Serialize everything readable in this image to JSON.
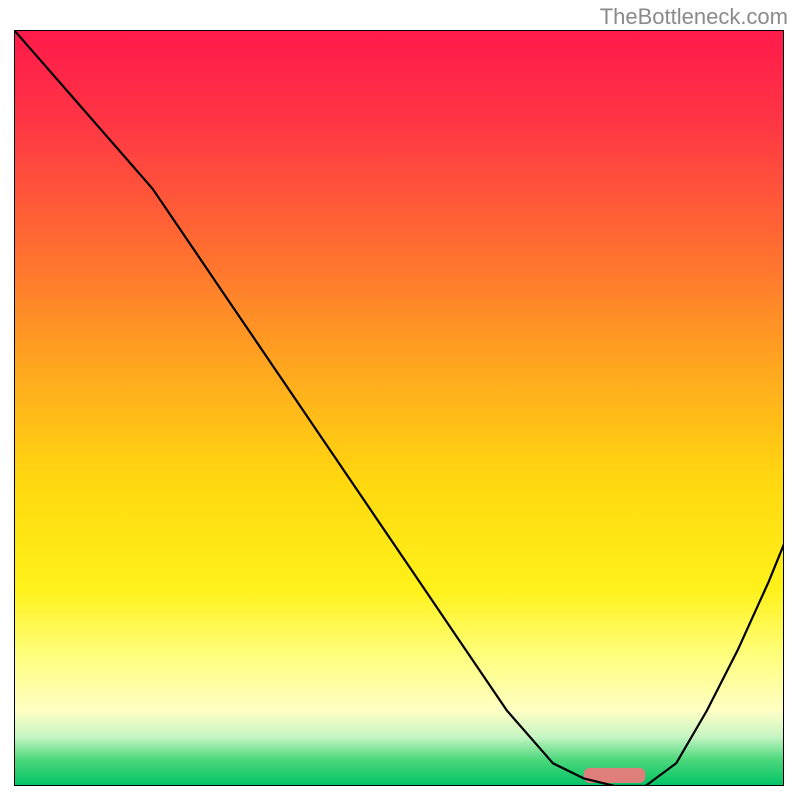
{
  "watermark": "TheBottleneck.com",
  "chart_data": {
    "type": "line",
    "title": "",
    "xlabel": "",
    "ylabel": "",
    "xlim": [
      0,
      100
    ],
    "ylim": [
      0,
      100
    ],
    "grid": false,
    "legend": false,
    "background_gradient": {
      "stops": [
        {
          "offset": 0.0,
          "color": "#ff1a4a"
        },
        {
          "offset": 0.12,
          "color": "#ff3545"
        },
        {
          "offset": 0.28,
          "color": "#ff6a32"
        },
        {
          "offset": 0.45,
          "color": "#ffa81e"
        },
        {
          "offset": 0.6,
          "color": "#ffd90f"
        },
        {
          "offset": 0.74,
          "color": "#fff21a"
        },
        {
          "offset": 0.83,
          "color": "#ffff80"
        },
        {
          "offset": 0.9,
          "color": "#ffffc4"
        },
        {
          "offset": 0.935,
          "color": "#c6f5c3"
        },
        {
          "offset": 0.965,
          "color": "#4dd87c"
        },
        {
          "offset": 1.0,
          "color": "#00c466"
        }
      ]
    },
    "series": [
      {
        "name": "bottleneck-curve",
        "type": "line",
        "color": "#000000",
        "x": [
          0,
          6,
          12,
          18,
          22,
          28,
          34,
          40,
          46,
          52,
          58,
          64,
          70,
          74,
          78,
          82,
          86,
          90,
          94,
          98,
          100
        ],
        "y": [
          100,
          93,
          86,
          79,
          73,
          64,
          55,
          46,
          37,
          28,
          19,
          10,
          3,
          1,
          0,
          0,
          3,
          10,
          18,
          27,
          32
        ]
      },
      {
        "name": "optimal-marker",
        "type": "bar",
        "color": "#de7f7b",
        "x": [
          78
        ],
        "width": 8,
        "y": [
          2
        ]
      }
    ],
    "annotations": []
  }
}
